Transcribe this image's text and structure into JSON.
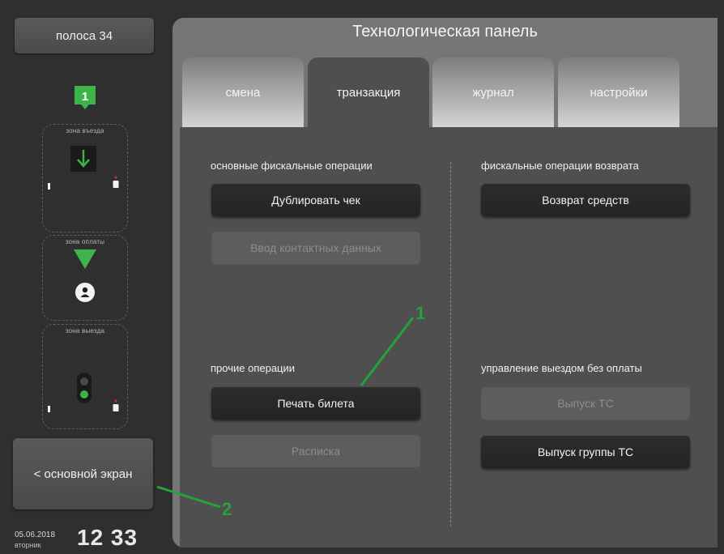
{
  "lane_button": "полоса 34",
  "marker_number": "1",
  "zones": [
    {
      "label": "зона въезда"
    },
    {
      "label": "зона оплаты"
    },
    {
      "label": "зона выезда"
    }
  ],
  "main_screen_button": "< основной экран",
  "datetime": {
    "date": "05.06.2018",
    "weekday": "вторник",
    "time": "12 33"
  },
  "panel": {
    "title": "Технологическая панель",
    "tabs": [
      {
        "label": "смена",
        "active": false
      },
      {
        "label": "транзакция",
        "active": true
      },
      {
        "label": "журнал",
        "active": false
      },
      {
        "label": "настройки",
        "active": false
      }
    ],
    "sections": {
      "fiscal_main": {
        "title": "основные фискальные операции",
        "duplicate": "Дублировать чек",
        "contact": "Ввод контактных данных"
      },
      "fiscal_return": {
        "title": "фискальные операции возврата",
        "refund": "Возврат средств"
      },
      "other": {
        "title": "прочие операции",
        "print_ticket": "Печать билета",
        "receipt": "Расписка"
      },
      "exit_no_pay": {
        "title": "управление выездом без оплаты",
        "release": "Выпуск ТС",
        "release_group": "Выпуск группы ТС"
      }
    }
  },
  "annotations": {
    "one": "1",
    "two": "2"
  },
  "colors": {
    "accent_green": "#3cb44b",
    "annotation_green": "#24a339"
  }
}
